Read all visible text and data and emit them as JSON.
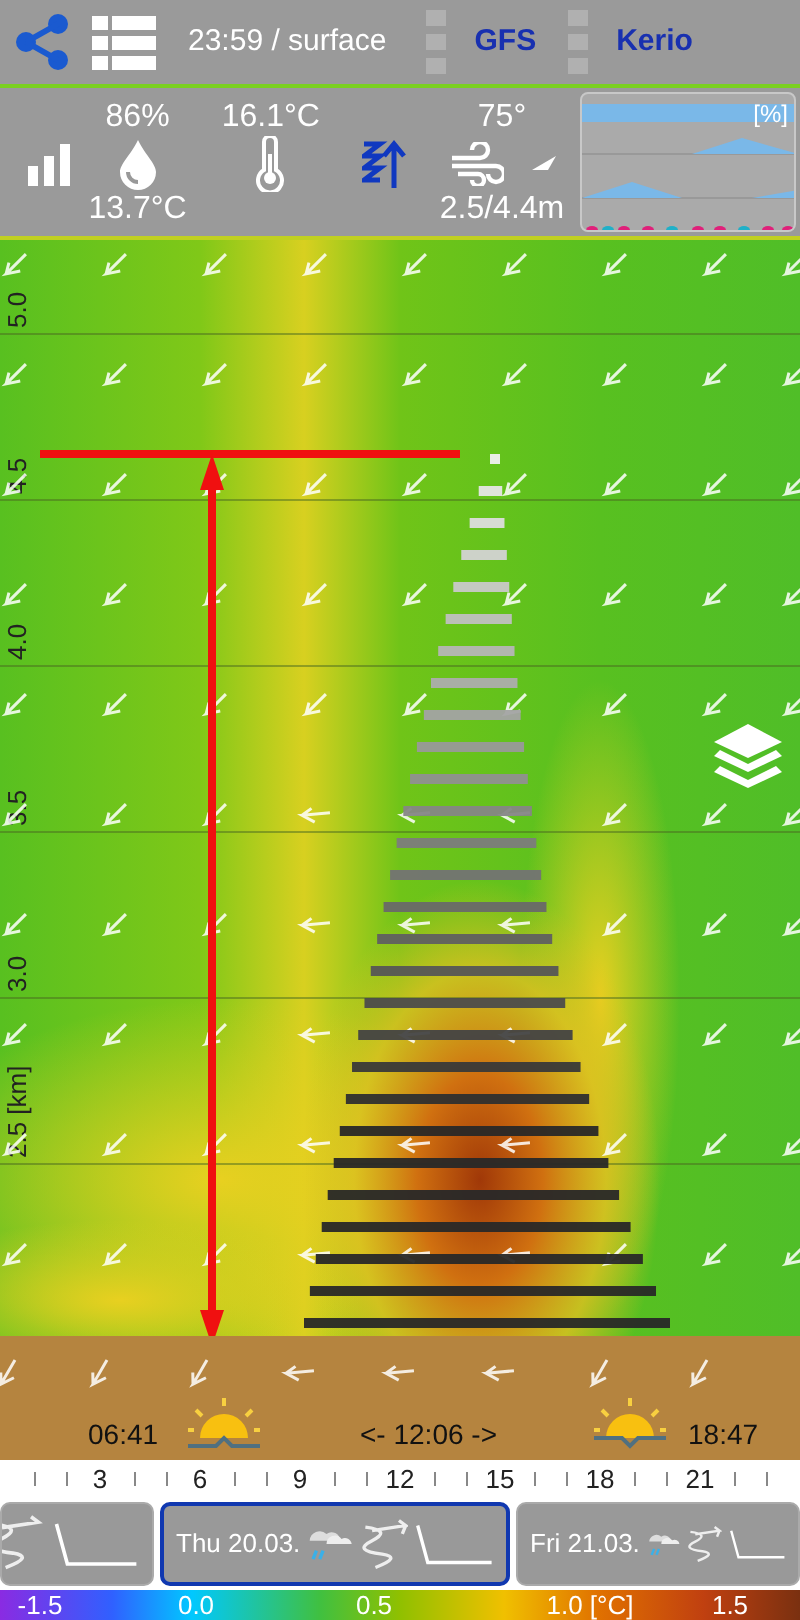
{
  "header": {
    "time_level": "23:59 / surface",
    "models": [
      {
        "label": "GFS"
      },
      {
        "label": "Kerio"
      }
    ]
  },
  "stats": {
    "humidity": "86%",
    "dew_point": "13.7°C",
    "temperature": "16.1°C",
    "wind_direction": "75°",
    "wind_speed": "2.5/4.4m"
  },
  "mini_chart": {
    "unit": "[%]"
  },
  "chart": {
    "altitude_labels": [
      "5.0",
      "4.5",
      "4.0",
      "3.5",
      "3.0",
      "2.5 [km]"
    ]
  },
  "sun": {
    "sunrise": "06:41",
    "day_length": "<- 12:06 ->",
    "sunset": "18:47"
  },
  "time_axis": [
    "3",
    "6",
    "9",
    "12",
    "15",
    "18",
    "21"
  ],
  "days": [
    {
      "label": "Thu 20.03.",
      "selected": true
    },
    {
      "label": "Fri 21.03.",
      "selected": false
    }
  ],
  "color_scale": [
    "-1.5",
    "0.0",
    "0.5",
    "1.0 [°C]",
    "1.5"
  ]
}
